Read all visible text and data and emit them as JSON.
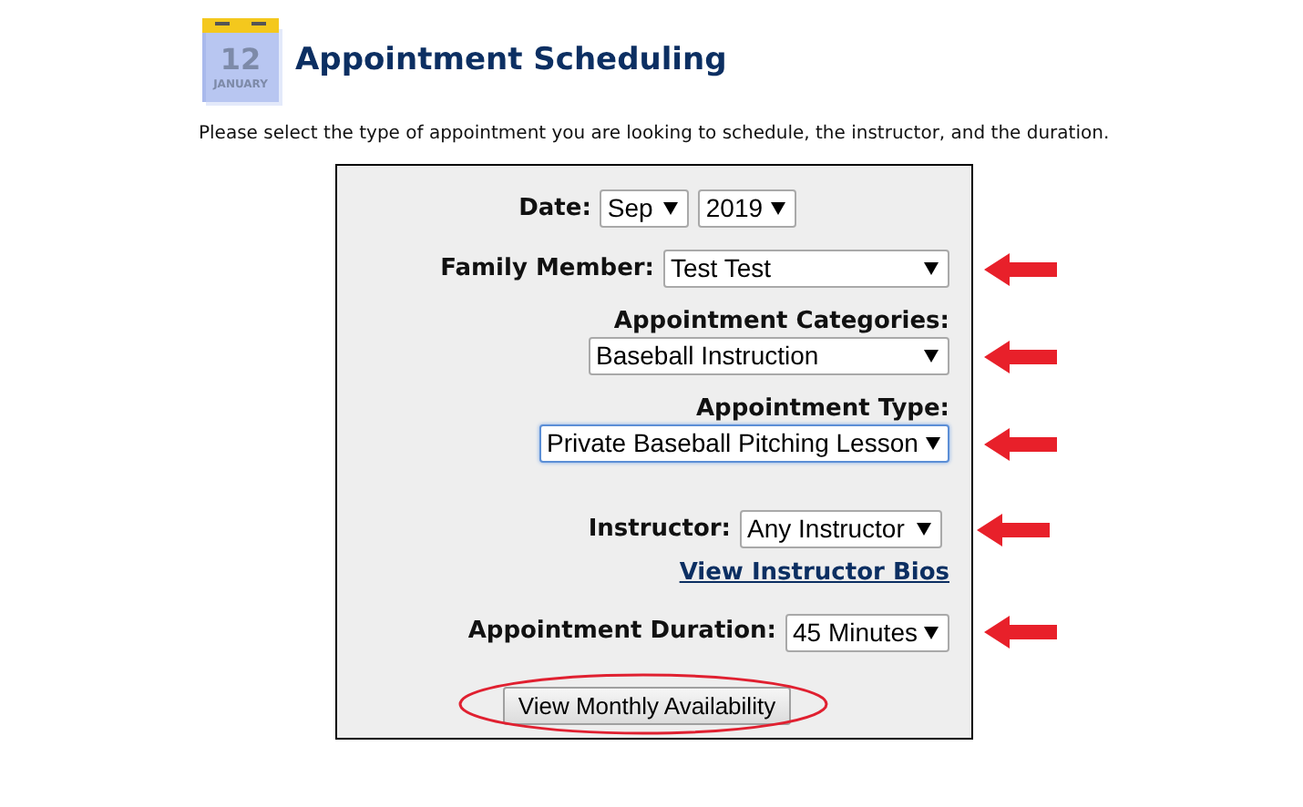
{
  "header": {
    "icon_day": "12",
    "icon_month": "JANUARY",
    "title": "Appointment Scheduling"
  },
  "instructions": "Please select the type of appointment you are looking to schedule, the instructor, and the duration.",
  "form": {
    "date": {
      "label": "Date:",
      "month": "Sep",
      "year": "2019"
    },
    "fields": [
      {
        "label": "Family Member:",
        "value": "Test Test",
        "kind": "inline",
        "focused": false,
        "arrow": true
      },
      {
        "label": "Appointment Categories:",
        "value": "Baseball Instruction",
        "kind": "stacked",
        "focused": false,
        "arrow": true
      },
      {
        "label": "Appointment Type:",
        "value": "Private Baseball Pitching Lesson",
        "kind": "stacked",
        "focused": true,
        "arrow": true
      },
      {
        "label": "Instructor:",
        "value": "Any Instructor",
        "kind": "inline",
        "focused": false,
        "arrow": true,
        "link": "View Instructor Bios"
      },
      {
        "label": "Appointment Duration:",
        "value": "45 Minutes",
        "kind": "inline",
        "focused": false,
        "arrow": true
      }
    ],
    "button": {
      "label": "View Monthly Availability",
      "circled": true
    }
  }
}
